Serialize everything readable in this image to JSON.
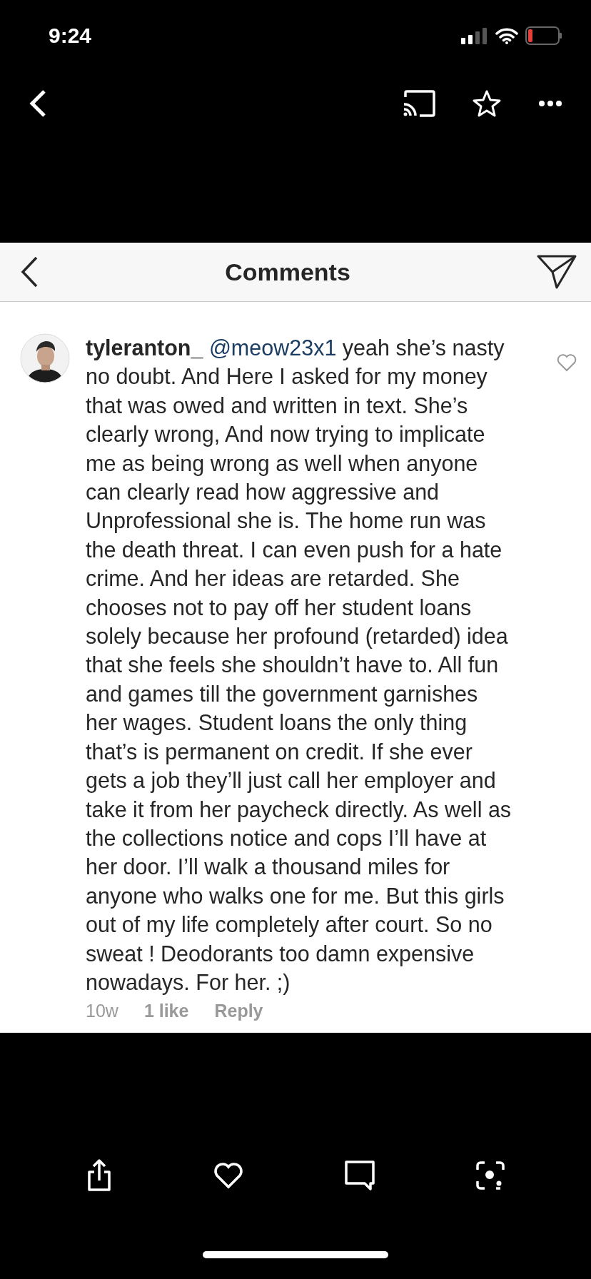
{
  "status_bar": {
    "time": "9:24"
  },
  "header": {
    "title": "Comments"
  },
  "comment": {
    "username": "tyleranton_",
    "mention": "@meow23x1",
    "text": "yeah she’s nasty no doubt. And Here I asked for my money that was owed and written in text. She’s clearly wrong, And now trying to implicate me as being wrong as well when anyone can clearly read how aggressive and Unprofessional she is. The home run was the death threat. I can even push for a hate crime. And her ideas are retarded. She chooses not to pay off her student loans solely because her profound (retarded) idea that she feels she shouldn’t have to. All fun and games till the government garnishes her wages. Student loans the only thing that’s is permanent on credit. If she ever gets a job they’ll just call her employer and take it from her paycheck directly. As well as the collections notice and cops I’ll have at her door. I’ll walk a thousand miles for anyone who walks one for me. But this girls out of my life completely after court. So no sweat ! Deodorants too damn expensive nowadays. For her. ;)",
    "age": "10w",
    "likes": "1 like",
    "reply": "Reply"
  }
}
